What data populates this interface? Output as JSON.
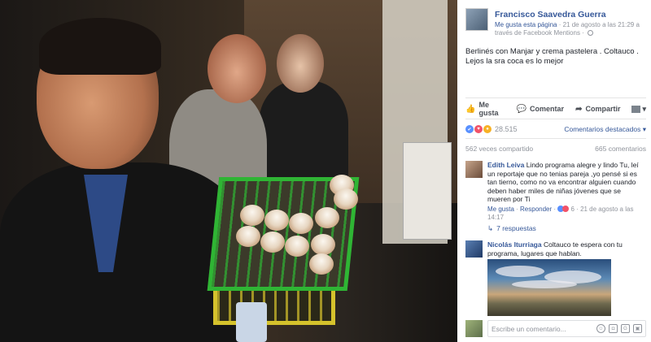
{
  "post": {
    "author": "Francisco Saavedra Guerra",
    "meta_like_page": "Me gusta esta página",
    "meta_rest": " · 21 de agosto a las 21:29 a través de Facebook Mentions ·",
    "icon": "globe-icon",
    "caption": "Berlinés con Manjar y crema pastelera . Coltauco . Lejos la sra coca es lo mejor"
  },
  "actions": {
    "like": "Me gusta",
    "comment": "Comentar",
    "share": "Compartir"
  },
  "reactions": {
    "count": "28.515",
    "top_comments": "Comentarios destacados ▾"
  },
  "stats": {
    "shares": "562 veces compartido",
    "comments": "665 comentarios"
  },
  "comments": [
    {
      "name": "Edith Leiva",
      "text": " Lindo programa alegre y lindo Tu, leí un reportaje que no tenias pareja ,yo pensé si es tan tierno, como no va encontrar alguien cuando deben haber miles de niñas jóvenes que se mueren por Ti",
      "like": "Me gusta",
      "reply": "Responder",
      "reaction_count": "6",
      "time": "21 de agosto a las 14:17",
      "replies": "7 respuestas"
    },
    {
      "name": "Nicolás Iturriaga",
      "text": " Coltauco te espera con tu programa, lugares que hablan."
    }
  ],
  "composer": {
    "placeholder": "Escribe un comentario..."
  },
  "colors": {
    "link": "#365899",
    "muted": "#90949c",
    "like_blue": "#5890ff",
    "love_red": "#f25268",
    "wow_yellow": "#f7b125",
    "crate_green": "#2fb534",
    "crate_yellow": "#d5c22c"
  }
}
